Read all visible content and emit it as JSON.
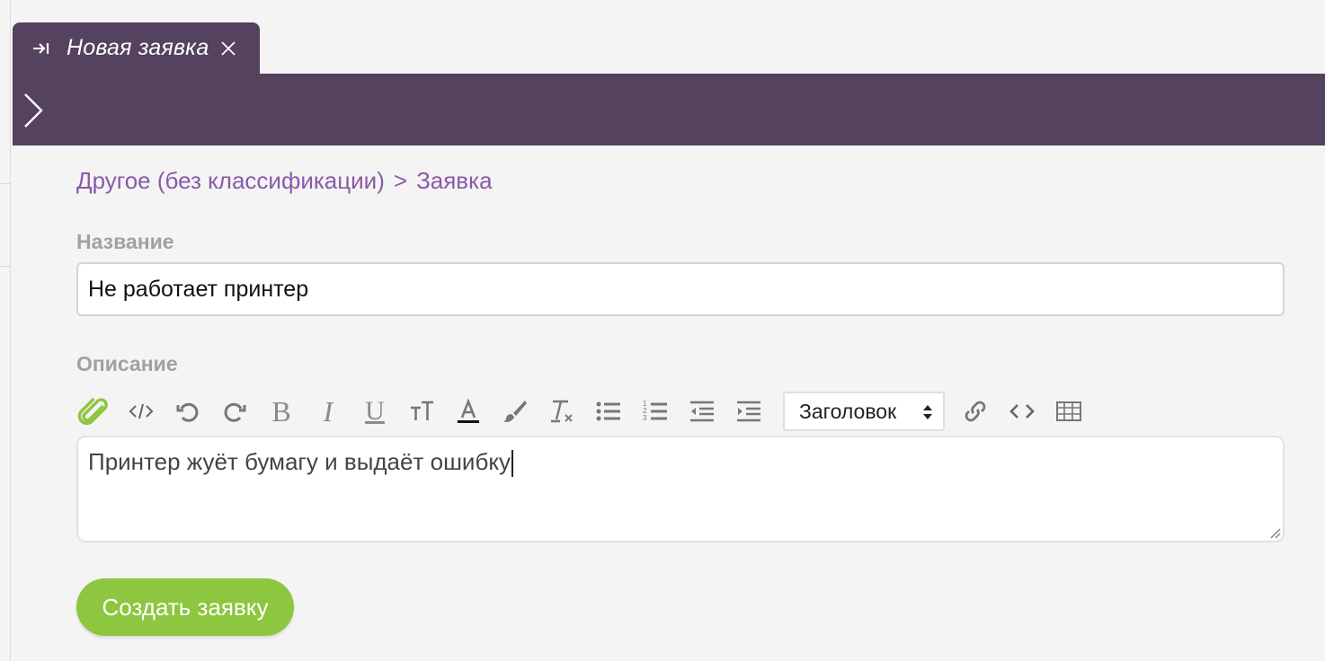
{
  "tab": {
    "title": "Новая заявка"
  },
  "breadcrumb": {
    "category": "Другое (без классификации)",
    "separator": ">",
    "current": "Заявка"
  },
  "form": {
    "name_label": "Название",
    "name_value": "Не работает принтер",
    "description_label": "Описание",
    "description_value": "Принтер жуёт бумагу и выдаёт ошибку",
    "submit_label": "Создать заявку"
  },
  "toolbar": {
    "bold": "B",
    "italic": "I",
    "underline": "U",
    "heading_select": "Заголовок"
  },
  "colors": {
    "header": "#54425f",
    "link": "#8a5aa8",
    "submit": "#8dc63f",
    "attach": "#8dc63f"
  }
}
